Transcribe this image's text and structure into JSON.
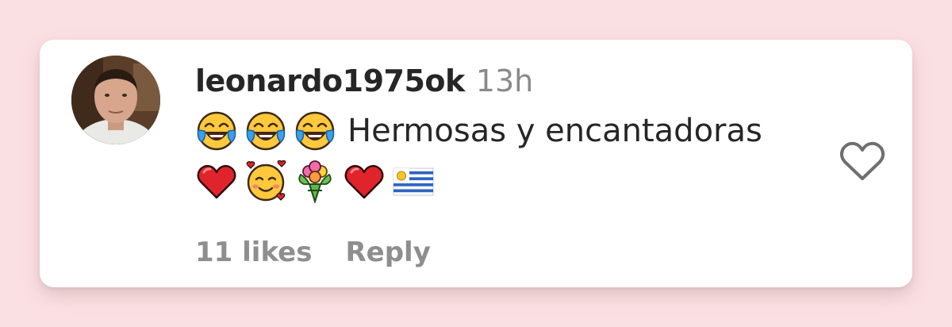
{
  "comment": {
    "username": "leonardo1975ok",
    "timestamp": "13h",
    "text": "Hermosas y encantadoras",
    "leading_emojis": [
      "face-with-tears-of-joy",
      "face-with-tears-of-joy",
      "face-with-tears-of-joy"
    ],
    "trailing_emojis": [
      "red-heart",
      "smiling-face-with-hearts",
      "bouquet",
      "red-heart",
      "flag-uruguay"
    ],
    "likes_label": "11 likes",
    "reply_label": "Reply"
  },
  "icons": {
    "like": "heart-outline-icon",
    "avatar": "user-avatar"
  },
  "colors": {
    "background": "#fbe0e3",
    "card": "#ffffff",
    "username": "#262626",
    "muted": "#8e8e8e",
    "heart_outline": "#6f6f6f"
  }
}
